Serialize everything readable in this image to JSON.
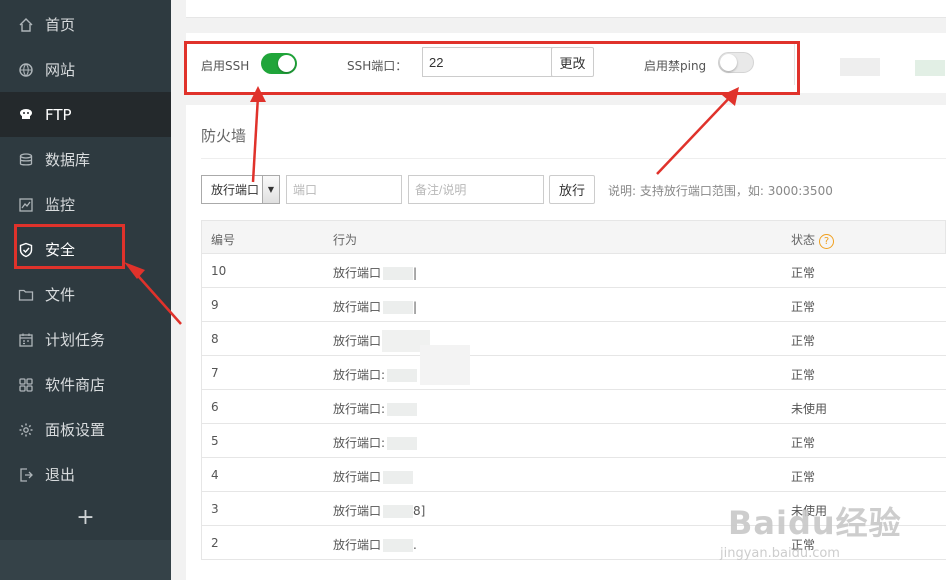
{
  "sidebar": {
    "items": [
      {
        "label": "首页",
        "icon": "home-icon"
      },
      {
        "label": "网站",
        "icon": "globe-icon"
      },
      {
        "label": "FTP",
        "icon": "ftp-icon"
      },
      {
        "label": "数据库",
        "icon": "database-icon"
      },
      {
        "label": "监控",
        "icon": "monitor-icon"
      },
      {
        "label": "安全",
        "icon": "shield-icon"
      },
      {
        "label": "文件",
        "icon": "folder-icon"
      },
      {
        "label": "计划任务",
        "icon": "calendar-icon"
      },
      {
        "label": "软件商店",
        "icon": "grid-icon"
      },
      {
        "label": "面板设置",
        "icon": "gear-icon"
      },
      {
        "label": "退出",
        "icon": "logout-icon"
      }
    ],
    "add_label": "+",
    "active_index": 2,
    "highlighted_index": 5
  },
  "ssh": {
    "enable_ssh_label": "启用SSH",
    "enable_ssh_on": true,
    "port_label": "SSH端口：",
    "port_value": "22",
    "change_button": "更改",
    "ping_label": "启用禁ping",
    "ping_on": false
  },
  "firewall": {
    "title": "防火墙",
    "select_value": "放行端口",
    "port_placeholder": "端口",
    "note_placeholder": "备注/说明",
    "allow_button": "放行",
    "hint": "说明: 支持放行端口范围，如: 3000:3500",
    "columns": [
      "编号",
      "行为",
      "状态"
    ],
    "rows": [
      {
        "id": "10",
        "action": "放行端口",
        "suffix": "|",
        "status": "正常"
      },
      {
        "id": "9",
        "action": "放行端口",
        "suffix": "|",
        "status": "正常"
      },
      {
        "id": "8",
        "action": "放行端口",
        "suffix": "",
        "status": "正常"
      },
      {
        "id": "7",
        "action": "放行端口:",
        "suffix": "",
        "status": "正常"
      },
      {
        "id": "6",
        "action": "放行端口:",
        "suffix": "",
        "status": "未使用"
      },
      {
        "id": "5",
        "action": "放行端口:",
        "suffix": "",
        "status": "正常"
      },
      {
        "id": "4",
        "action": "放行端口",
        "suffix": "",
        "status": "正常"
      },
      {
        "id": "3",
        "action": "放行端口",
        "suffix": "8]",
        "status": "未使用"
      },
      {
        "id": "2",
        "action": "放行端口",
        "suffix": ".",
        "status": "正常"
      }
    ]
  },
  "watermark": {
    "brand": "Baidu经验",
    "url": "jingyan.baidu.com"
  },
  "colors": {
    "sidebar_bg": "#2e3a40",
    "accent_green": "#20a53a",
    "annotation_red": "#e0322b",
    "help_orange": "#f0a020"
  }
}
